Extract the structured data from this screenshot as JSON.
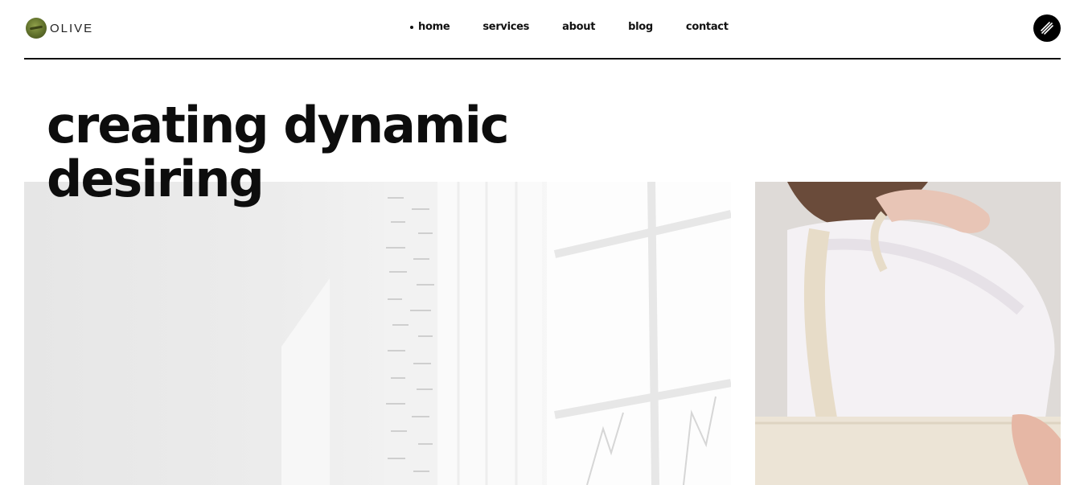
{
  "header": {
    "logo_text": "OLIVE",
    "nav": [
      {
        "label": "home",
        "active": true
      },
      {
        "label": "services",
        "active": false
      },
      {
        "label": "about",
        "active": false
      },
      {
        "label": "blog",
        "active": false
      },
      {
        "label": "contact",
        "active": false
      }
    ],
    "menu_icon": "menu-lines-icon"
  },
  "hero": {
    "line1": "creating dynamic",
    "line2": "desiring"
  },
  "images": {
    "left": "bright-room-window-photo",
    "right": "woman-tote-bag-photo"
  },
  "colors": {
    "text": "#111111",
    "background": "#ffffff",
    "logo": "#6b7a2e"
  }
}
